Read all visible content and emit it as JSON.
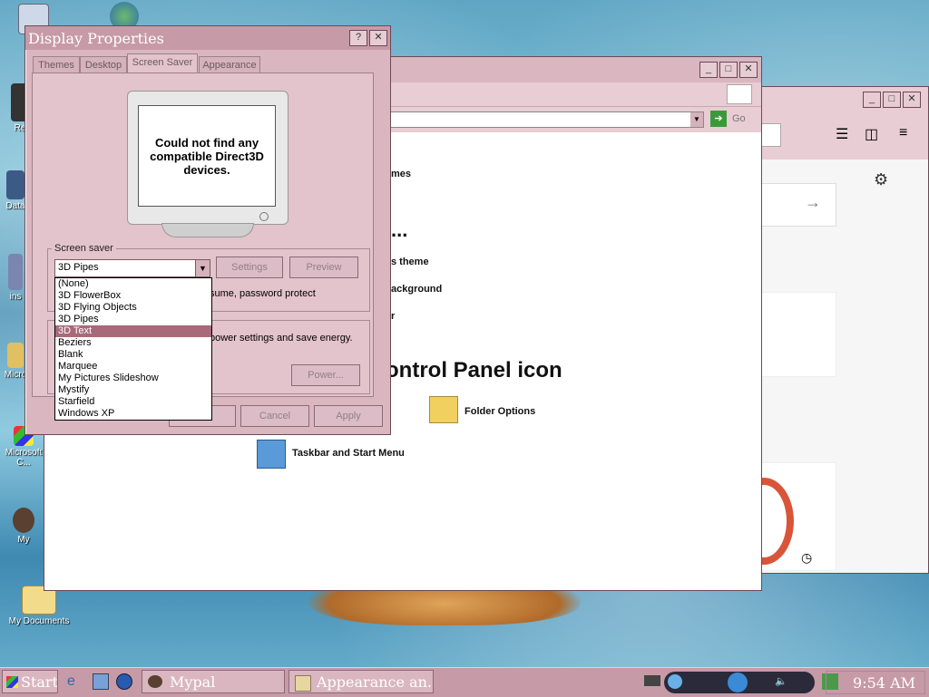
{
  "desktop": {
    "icons": [
      {
        "label": "My"
      },
      {
        "label": "Re"
      },
      {
        "label": "Data"
      },
      {
        "label": "ins"
      },
      {
        "label": "Micro"
      },
      {
        "label": "Microsoft C..."
      },
      {
        "label": "My"
      },
      {
        "label": "My Documents"
      }
    ]
  },
  "display_properties": {
    "title": "Display Properties",
    "help_btn": "?",
    "close_btn": "✕",
    "tabs": [
      "Themes",
      "Desktop",
      "Screen Saver",
      "Appearance"
    ],
    "active_tab": "Screen Saver",
    "preview_message": "Could not find any compatible Direct3D devices.",
    "screen_saver_group_label": "Screen saver",
    "selected_saver": "3D Pipes",
    "settings_label": "Settings",
    "preview_label": "Preview",
    "resume_text": "sume, password protect",
    "power_text": "power settings and save energy.",
    "power_button": "Power...",
    "ok_label": "OK",
    "cancel_label": "Cancel",
    "apply_label": "Apply",
    "dropdown_options": [
      "(None)",
      "3D FlowerBox",
      "3D Flying Objects",
      "3D Pipes",
      "3D Text",
      "Beziers",
      "Blank",
      "Marquee",
      "My Pictures Slideshow",
      "Mystify",
      "Starfield",
      "Windows XP"
    ],
    "highlighted_option": "3D Text"
  },
  "control_panel": {
    "go_label": "Go",
    "frag_themes": "mes",
    "frag_dots": "...",
    "frag_theme": "s theme",
    "frag_background": "ackground",
    "frag_r": "r",
    "heading": "ontrol Panel icon",
    "folder_options": "Folder Options",
    "taskbar_start": "Taskbar and Start Menu"
  },
  "taskbar": {
    "start": "Start",
    "items": [
      "Mypal",
      "Appearance an..."
    ],
    "time": "9:54 AM"
  }
}
